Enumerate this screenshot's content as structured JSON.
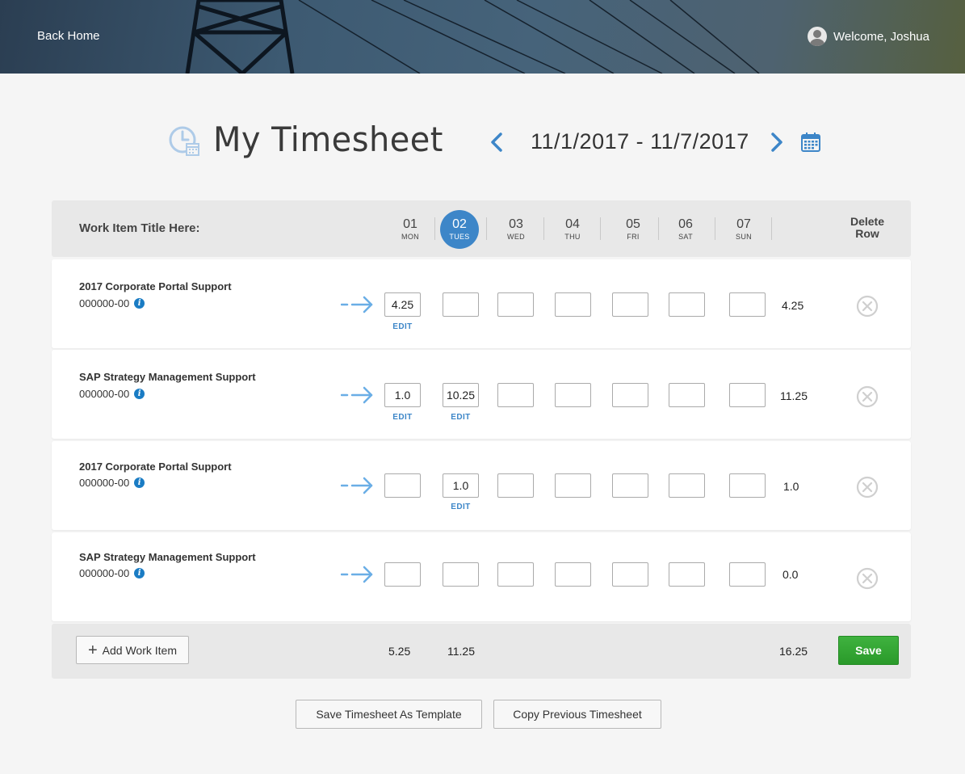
{
  "header": {
    "back_home": "Back Home",
    "welcome": "Welcome, Joshua"
  },
  "title": {
    "text": "My Timesheet",
    "date_range": "11/1/2017 - 11/7/2017"
  },
  "table": {
    "work_item_label": "Work Item Title Here:",
    "delete_label_1": "Delete",
    "delete_label_2": "Row",
    "days": [
      {
        "num": "01",
        "name": "MON"
      },
      {
        "num": "02",
        "name": "TUES"
      },
      {
        "num": "03",
        "name": "WED"
      },
      {
        "num": "04",
        "name": "THU"
      },
      {
        "num": "05",
        "name": "FRI"
      },
      {
        "num": "06",
        "name": "SAT"
      },
      {
        "num": "07",
        "name": "SUN"
      }
    ],
    "edit_label": "EDIT",
    "rows": [
      {
        "title": "2017 Corporate Portal Support",
        "code": "000000-00",
        "cells": [
          "4.25",
          "",
          "",
          "",
          "",
          "",
          ""
        ],
        "total": "4.25"
      },
      {
        "title": "SAP Strategy Management Support",
        "code": "000000-00",
        "cells": [
          "1.0",
          "10.25",
          "",
          "",
          "",
          "",
          ""
        ],
        "total": "11.25"
      },
      {
        "title": "2017 Corporate Portal Support",
        "code": "000000-00",
        "cells": [
          "",
          "1.0",
          "",
          "",
          "",
          "",
          ""
        ],
        "total": "1.0"
      },
      {
        "title": "SAP Strategy Management Support",
        "code": "000000-00",
        "cells": [
          "",
          "",
          "",
          "",
          "",
          "",
          ""
        ],
        "total": "0.0"
      }
    ]
  },
  "footer": {
    "add_label": "Add Work Item",
    "sum_mon": "5.25",
    "sum_tue": "11.25",
    "grand_total": "16.25",
    "save_label": "Save"
  },
  "actions": {
    "save_template": "Save Timesheet As Template",
    "copy_previous": "Copy Previous Timesheet"
  },
  "colors": {
    "accent": "#3d86c8",
    "save_green": "#2ea22e",
    "arrow_blue": "#6aaee6"
  }
}
